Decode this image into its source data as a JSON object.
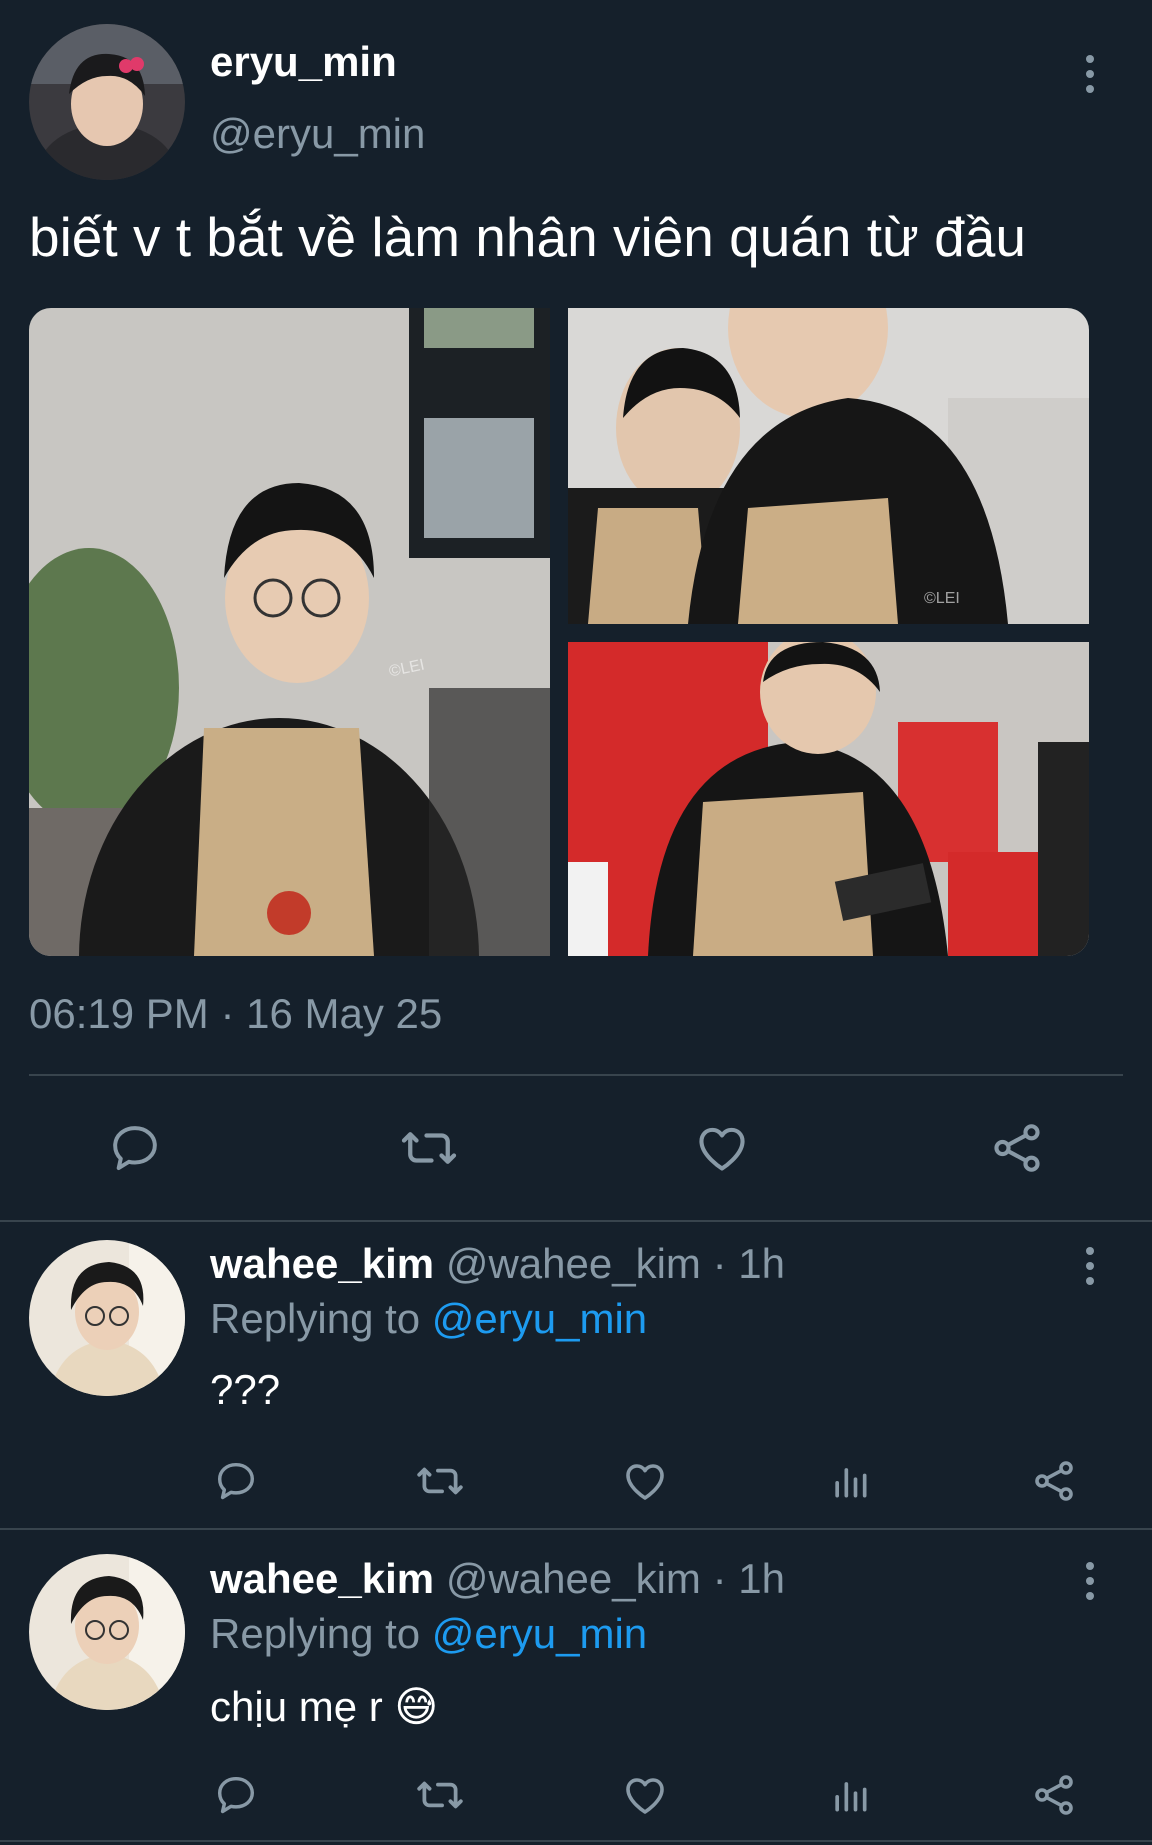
{
  "tweet": {
    "author_name": "eryu_min",
    "author_handle": "@eryu_min",
    "text": "biết v t bắt về làm nhân viên quán từ đầu",
    "time": "06:19 PM",
    "separator": "·",
    "date": "16 May 25",
    "photo_watermark": "©LEI",
    "actions": [
      "reply-icon",
      "retweet-icon",
      "like-icon",
      "share-icon"
    ]
  },
  "replies": [
    {
      "author_name": "wahee_kim",
      "author_handle": "@wahee_kim",
      "separator": "·",
      "time_ago": "1h",
      "replying_label": "Replying to",
      "replying_to": "@eryu_min",
      "text": "???"
    },
    {
      "author_name": "wahee_kim",
      "author_handle": "@wahee_kim",
      "separator": "·",
      "time_ago": "1h",
      "replying_label": "Replying to",
      "replying_to": "@eryu_min",
      "text": "chịu mẹ r 😅"
    }
  ],
  "colors": {
    "background": "#15202b",
    "muted_text": "#8899a6",
    "link": "#1d9bf0",
    "divider": "#38444d"
  }
}
